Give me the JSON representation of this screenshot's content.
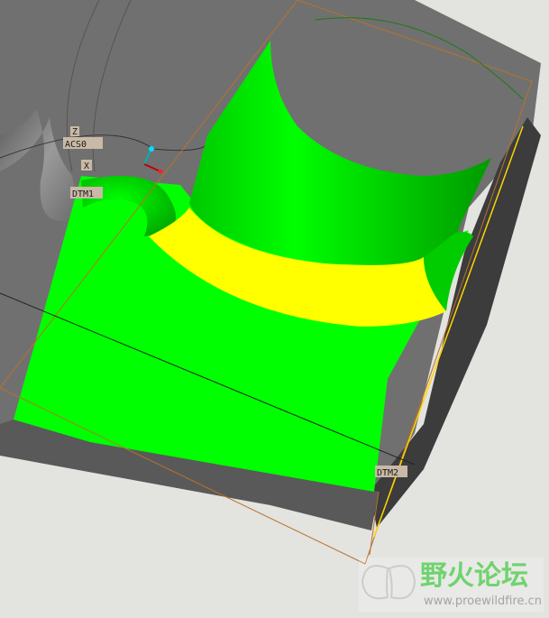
{
  "viewport": {
    "title": "",
    "datum_labels": {
      "csys": "ACS0",
      "csys_axis_z": "Z",
      "csys_axis_x": "X",
      "plane_1": "DTM1",
      "plane_2": "DTM2"
    }
  },
  "watermark": {
    "text_cn": "野火论坛",
    "url": "www.proewildfire.cn"
  },
  "colors": {
    "background": "#e3e3e0",
    "solid_gray": "#6e6e6e",
    "solid_dark": "#4a4a4a",
    "highlight_green": "#00ff00",
    "highlight_yellow": "#ffff00",
    "datum_orange": "#b8732a"
  }
}
